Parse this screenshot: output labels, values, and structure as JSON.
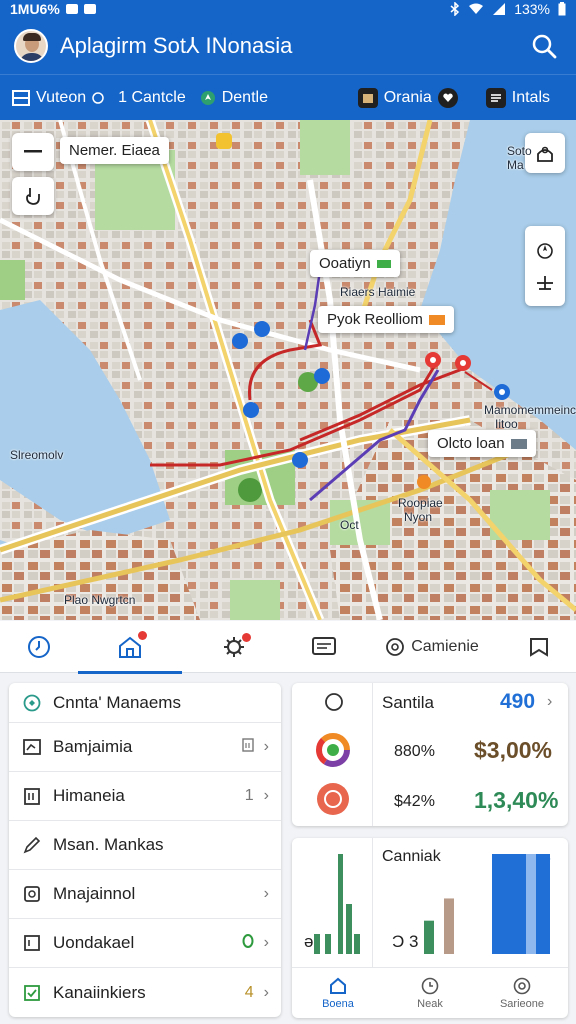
{
  "status_bar": {
    "time": "1MU6%",
    "battery": "133%"
  },
  "app_bar": {
    "title": "Aplagirm Sot⅄ INonasia"
  },
  "toolbar": {
    "item1_label": "Vuteon",
    "item2_label": "1 Cantcle",
    "item3_label": "Dentle",
    "item4_label": "Orania",
    "item5_label": "Intals"
  },
  "map": {
    "zoom_callout": "Nemer. Eiaea",
    "callout_1": "Ooatiyn",
    "callout_2": "Pyok Reolliom",
    "callout_3": "Olcto loan",
    "label_1": "Riaers Haimie",
    "label_2": "Mamomemmeince",
    "label_2b": "Iitoo",
    "label_3": "Slreomolv",
    "label_4": "Plao Nwgrtcn",
    "label_5": "Roopiae",
    "label_5b": "Nyon",
    "label_6": "Oct",
    "label_7": "Soto",
    "label_7b": "Ma"
  },
  "tabs": {
    "tab5_label": "Camienie"
  },
  "list": {
    "header": "Cnnta' Manaems",
    "rows": [
      {
        "label": "Bamjaimia",
        "meta": ""
      },
      {
        "label": "Himaneia",
        "meta": "1"
      },
      {
        "label": "Msan. Mankas",
        "meta": ""
      },
      {
        "label": "Mnajainnol",
        "meta": ""
      },
      {
        "label": "Uondakael",
        "meta": ""
      },
      {
        "label": "Kanaiinkiers",
        "meta": "4"
      }
    ]
  },
  "stats": {
    "title": "Santila",
    "value": "490",
    "row1_pct": "880%",
    "row1_value": "$3,00%",
    "row2_pct": "$42%",
    "row2_value": "1,3,40%"
  },
  "chart_card": {
    "title": "Canniak",
    "left_marks": "ǝ.",
    "right_marks": "Ɔ 3",
    "nav": [
      "Boena",
      "Neak",
      "Sarieone"
    ]
  },
  "chart_data": [
    {
      "type": "bar",
      "series": [
        {
          "values": [
            2,
            2,
            10,
            5,
            2
          ]
        }
      ]
    },
    {
      "type": "bar",
      "series": [
        {
          "values": [
            3,
            5,
            9
          ]
        }
      ]
    }
  ],
  "colors": {
    "primary": "#1565c8",
    "route_red": "#c62828",
    "route_purple": "#5b3db5",
    "bar_green": "#3e8f5e",
    "bar_tan": "#b79a87",
    "bar_blue": "#1f6fd6",
    "stat_blue": "#1f6fd6",
    "stat_brown": "#6b4e2a",
    "stat_green": "#2e8b57"
  }
}
